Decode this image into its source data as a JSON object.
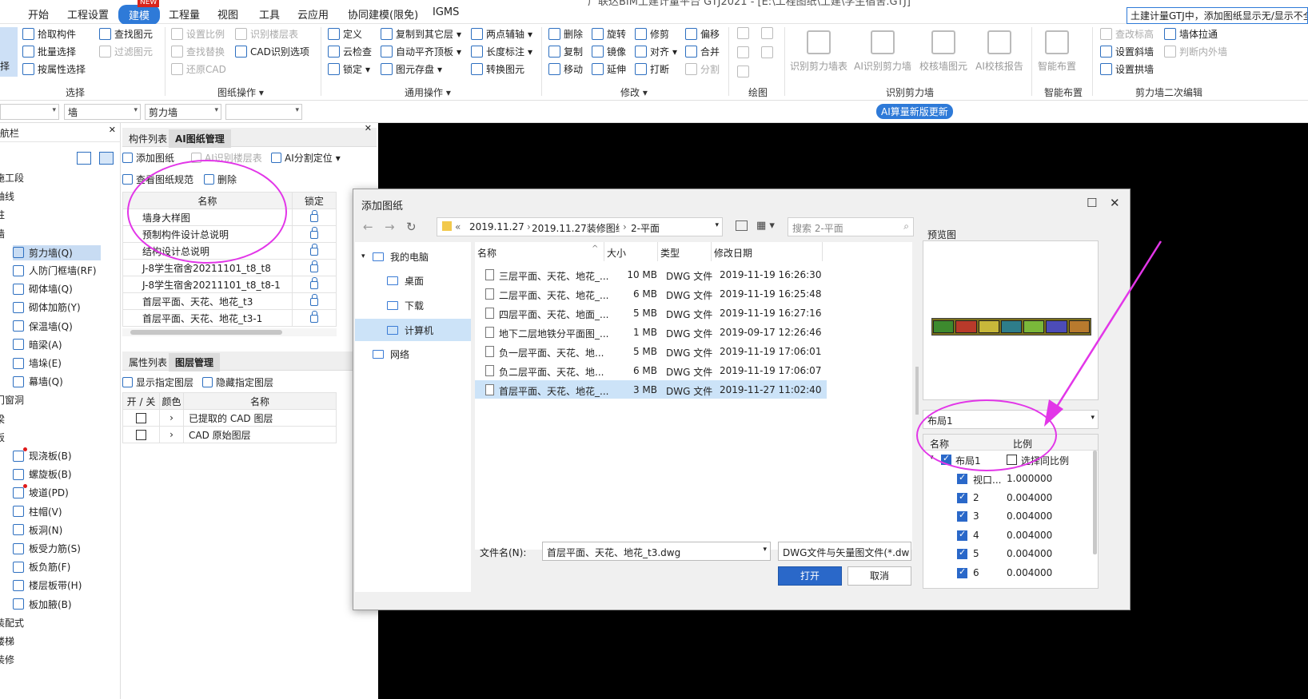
{
  "menubar": {
    "items": [
      "开始",
      "工程设置",
      "建模",
      "工程量",
      "视图",
      "工具",
      "云应用",
      "协同建模(限免)",
      "IGMS"
    ],
    "active_index": 2,
    "new_badge": "NEW",
    "title": "广联达BIM土建计量平台 GTJ2021 - [E:\\工程图纸\\土建\\学生宿舍.GTJ]",
    "notice": "土建计量GTJ中，添加图纸显示无/显示不全"
  },
  "ribbon": {
    "select": {
      "items": [
        "拾取构件",
        "批量选择",
        "按属性选择"
      ],
      "find": [
        "查找图元",
        "过滤图元"
      ],
      "edge_label": "择",
      "group": "选择"
    },
    "drawing_ops": {
      "items": [
        "设置比例",
        "识别楼层表",
        "查找替换",
        "CAD识别选项",
        "还原CAD",
        "云检查"
      ],
      "group": "图纸操作"
    },
    "general": {
      "items": [
        "定义",
        "复制到其它层",
        "两点辅轴",
        "云检查",
        "自动平齐顶板",
        "长度标注",
        "锁定",
        "图元存盘",
        "转换图元"
      ],
      "group": "通用操作"
    },
    "modify": {
      "items": [
        "删除",
        "旋转",
        "修剪",
        "偏移",
        "复制",
        "镜像",
        "对齐",
        "合并",
        "移动",
        "延伸",
        "打断",
        "分割"
      ],
      "group": "修改"
    },
    "draw": {
      "group": "绘图"
    },
    "recognize": {
      "items": [
        "识别剪力墙表",
        "AI识别剪力墙",
        "校核墙图元",
        "AI校核报告"
      ],
      "group": "识别剪力墙"
    },
    "smart": {
      "items": [
        "智能布置"
      ],
      "group": "智能布置"
    },
    "secondary": {
      "items": [
        "查改标高",
        "墙体拉通",
        "设置斜墙",
        "判断内外墙",
        "设置拱墙"
      ],
      "group": "剪力墙二次编辑"
    }
  },
  "combos": {
    "values": [
      "",
      "墙",
      "剪力墙",
      ""
    ],
    "ai_badge": "AI算量新版更新"
  },
  "leftnav": {
    "title": "导航栏",
    "items": [
      {
        "label": "施工段",
        "sub": false
      },
      {
        "label": "轴线",
        "sub": false
      },
      {
        "label": "柱",
        "sub": false
      },
      {
        "label": "墙",
        "sub": false
      },
      {
        "label": "剪力墙(Q)",
        "sub": true,
        "selected": true
      },
      {
        "label": "人防门框墙(RF)",
        "sub": true
      },
      {
        "label": "砌体墙(Q)",
        "sub": true
      },
      {
        "label": "砌体加筋(Y)",
        "sub": true
      },
      {
        "label": "保温墙(Q)",
        "sub": true
      },
      {
        "label": "暗梁(A)",
        "sub": true
      },
      {
        "label": "墙垛(E)",
        "sub": true
      },
      {
        "label": "幕墙(Q)",
        "sub": true
      },
      {
        "label": "门窗洞",
        "sub": false
      },
      {
        "label": "梁",
        "sub": false
      },
      {
        "label": "板",
        "sub": false
      },
      {
        "label": "现浇板(B)",
        "sub": true,
        "dot": true
      },
      {
        "label": "螺旋板(B)",
        "sub": true
      },
      {
        "label": "坡道(PD)",
        "sub": true,
        "dot": true
      },
      {
        "label": "柱帽(V)",
        "sub": true
      },
      {
        "label": "板洞(N)",
        "sub": true
      },
      {
        "label": "板受力筋(S)",
        "sub": true
      },
      {
        "label": "板负筋(F)",
        "sub": true
      },
      {
        "label": "楼层板带(H)",
        "sub": true
      },
      {
        "label": "板加腋(B)",
        "sub": true
      },
      {
        "label": "装配式",
        "sub": false
      },
      {
        "label": "楼梯",
        "sub": false
      },
      {
        "label": "装修",
        "sub": false
      }
    ]
  },
  "midpanel": {
    "tabs_top": [
      "构件列表",
      "AI图纸管理"
    ],
    "tools": [
      "添加图纸",
      "AI识别楼层表",
      "AI分割定位",
      "查看图纸规范",
      "删除"
    ],
    "table_headers": [
      "名称",
      "锁定"
    ],
    "drawings": [
      "墙身大样图",
      "预制构件设计总说明",
      "结构设计总说明",
      "J-8学生宿舍20211101_t8_t8",
      "J-8学生宿舍20211101_t8_t8-1",
      "首层平面、天花、地花_t3",
      "首层平面、天花、地花_t3-1"
    ],
    "tabs_bottom": [
      "属性列表",
      "图层管理"
    ],
    "layer_tools": [
      "显示指定图层",
      "隐藏指定图层"
    ],
    "layer_headers": [
      "开 / 关",
      "颜色",
      "名称"
    ],
    "layers": [
      "已提取的 CAD 图层",
      "CAD 原始图层"
    ]
  },
  "dialog": {
    "title": "添加图纸",
    "path": [
      "2019.11.27",
      "2019.11.27装修图纸",
      "2-平面"
    ],
    "search_placeholder": "搜索 2-平面",
    "nav": [
      {
        "label": "我的电脑",
        "level": 0
      },
      {
        "label": "桌面",
        "level": 1
      },
      {
        "label": "下载",
        "level": 1
      },
      {
        "label": "计算机",
        "level": 1,
        "selected": true
      },
      {
        "label": "网络",
        "level": 0
      }
    ],
    "columns": [
      "名称",
      "大小",
      "类型",
      "修改日期"
    ],
    "files": [
      {
        "name": "三层平面、天花、地花_...",
        "size": "10 MB",
        "type": "DWG 文件",
        "date": "2019-11-19 16:26:30"
      },
      {
        "name": "二层平面、天花、地花_...",
        "size": "6 MB",
        "type": "DWG 文件",
        "date": "2019-11-19 16:25:48"
      },
      {
        "name": "四层平面、天花、地面_...",
        "size": "5 MB",
        "type": "DWG 文件",
        "date": "2019-11-19 16:27:16"
      },
      {
        "name": "地下二层地铁分平面图_...",
        "size": "1 MB",
        "type": "DWG 文件",
        "date": "2019-09-17 12:26:46"
      },
      {
        "name": "负一层平面、天花、地...",
        "size": "5 MB",
        "type": "DWG 文件",
        "date": "2019-11-19 17:06:01"
      },
      {
        "name": "负二层平面、天花、地...",
        "size": "6 MB",
        "type": "DWG 文件",
        "date": "2019-11-19 17:06:07"
      },
      {
        "name": "首层平面、天花、地花_...",
        "size": "3 MB",
        "type": "DWG 文件",
        "date": "2019-11-27 11:02:40",
        "selected": true
      }
    ],
    "filename_label": "文件名(N):",
    "filename_value": "首层平面、天花、地花_t3.dwg",
    "filetype_value": "DWG文件与矢量图文件(*.dw",
    "open_button": "打开",
    "cancel_button": "取消",
    "preview_label": "预览图",
    "layout_select": "布局1",
    "layout_headers": [
      "名称",
      "比例"
    ],
    "layout_root": "布局1",
    "same_scale": "选择同比例",
    "layouts": [
      {
        "name": "视口...",
        "scale": "1.000000"
      },
      {
        "name": "2",
        "scale": "0.004000"
      },
      {
        "name": "3",
        "scale": "0.004000"
      },
      {
        "name": "4",
        "scale": "0.004000"
      },
      {
        "name": "5",
        "scale": "0.004000"
      },
      {
        "name": "6",
        "scale": "0.004000"
      }
    ]
  },
  "colors": {
    "accent": "#2e7ad8",
    "annotation": "#e236e8",
    "canvas": "#000000",
    "selection": "#cce3f8"
  }
}
